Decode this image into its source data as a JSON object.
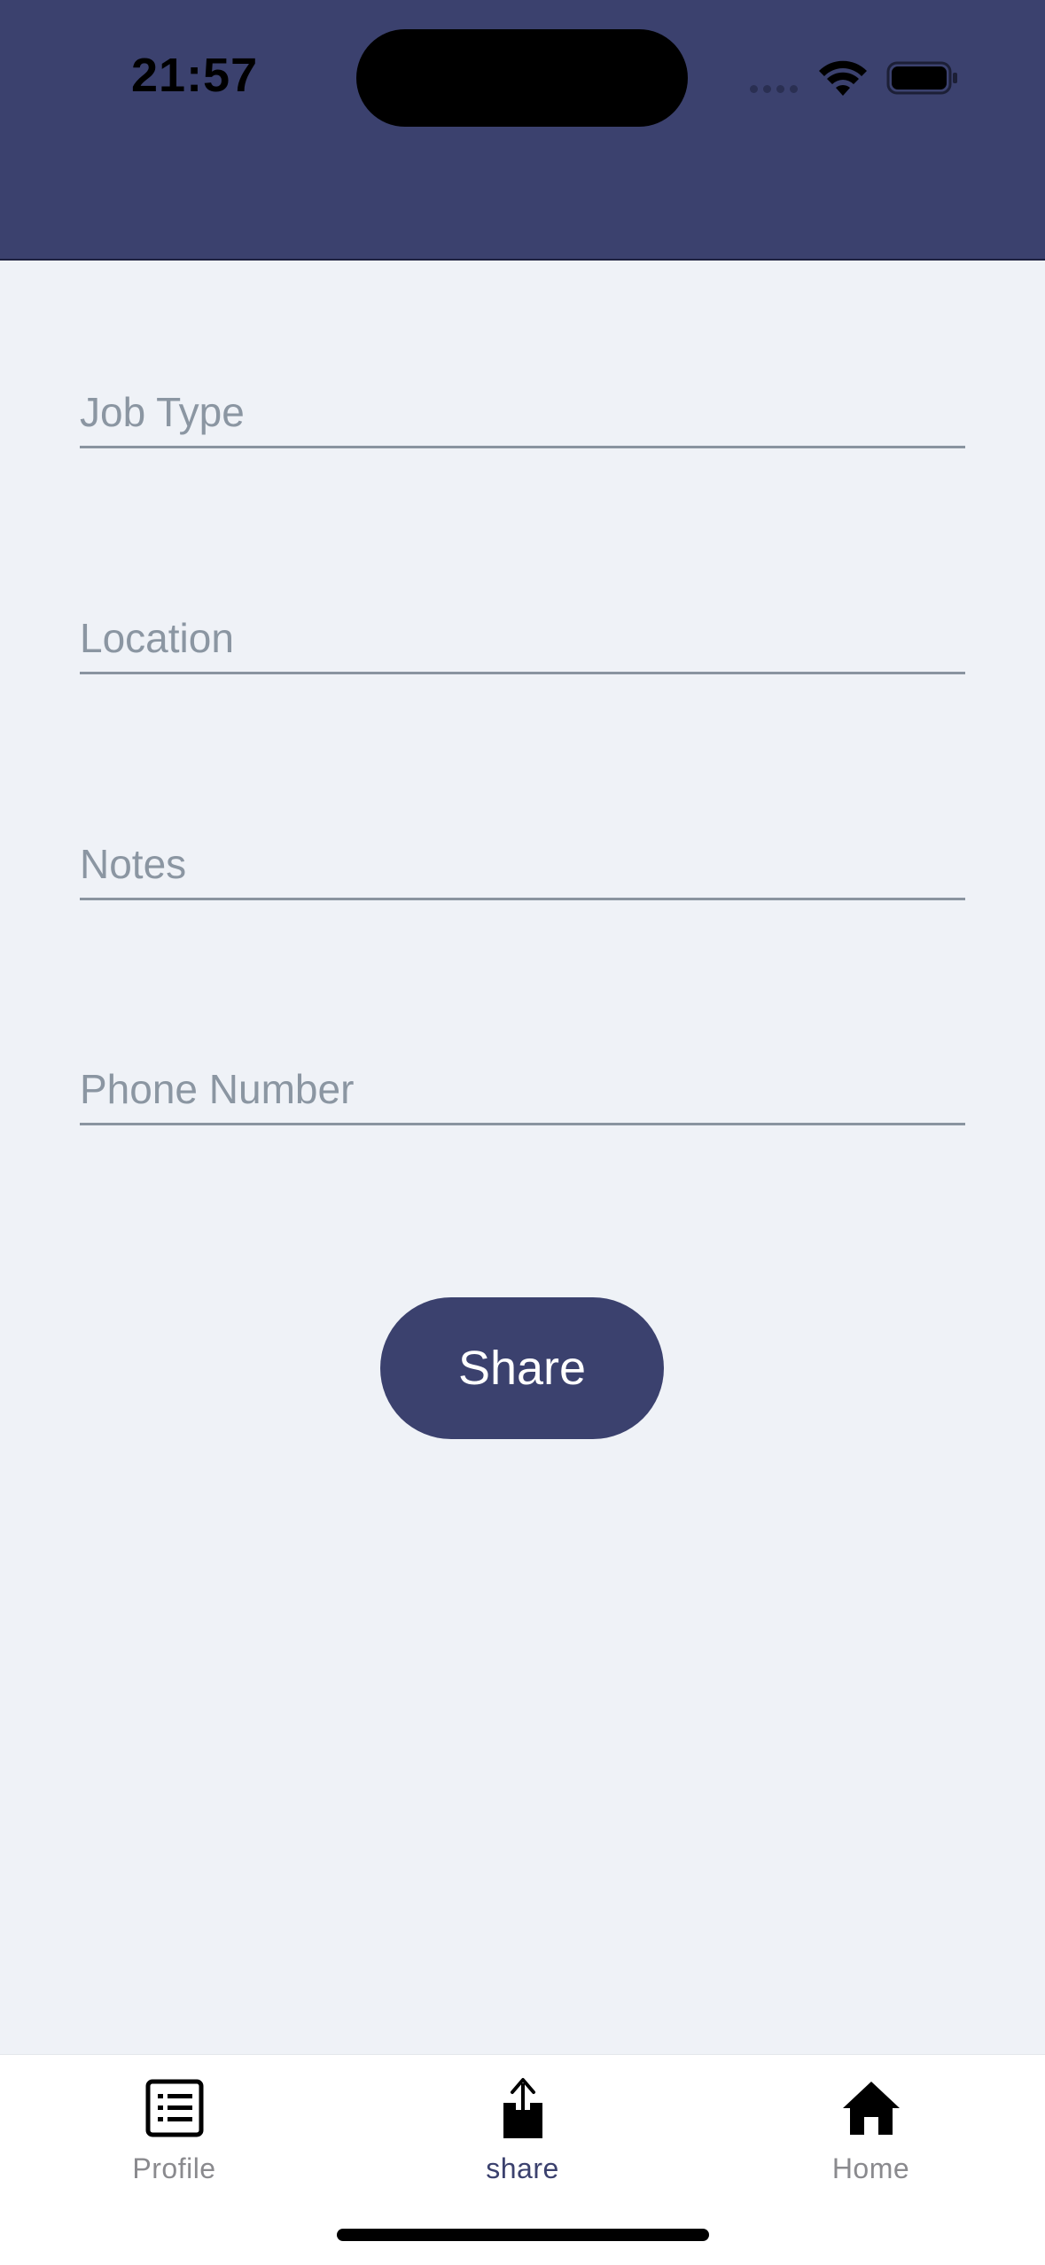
{
  "status_bar": {
    "time": "21:57"
  },
  "form": {
    "job_type_placeholder": "Job Type",
    "location_placeholder": "Location",
    "notes_placeholder": "Notes",
    "phone_placeholder": "Phone Number",
    "submit_label": "Share"
  },
  "tabbar": {
    "items": [
      {
        "label": "Profile",
        "icon": "list-icon",
        "active": false
      },
      {
        "label": "share",
        "icon": "share-icon",
        "active": true
      },
      {
        "label": "Home",
        "icon": "home-icon",
        "active": false
      }
    ]
  },
  "colors": {
    "primary": "#3b416e",
    "background": "#eff2f7",
    "placeholder": "#8b96a2",
    "inactive_tab": "#8a8a8e"
  }
}
